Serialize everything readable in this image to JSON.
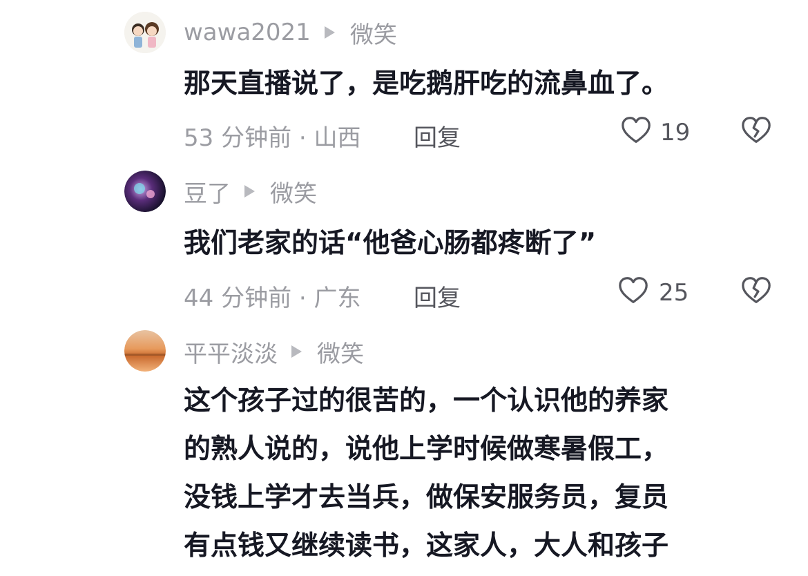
{
  "comments": [
    {
      "username": "wawa2021",
      "reply_to": "微笑",
      "lines": [
        "那天直播说了，是吃鹅肝吃的流鼻血了。"
      ],
      "time_location": "53 分钟前 · 山西",
      "reply_label": "回复",
      "likes": "19"
    },
    {
      "username": "豆了",
      "reply_to": "微笑",
      "lines": [
        "我们老家的话“他爸心肠都疼断了”"
      ],
      "time_location": "44 分钟前 · 广东",
      "reply_label": "回复",
      "likes": "25"
    },
    {
      "username": "平平淡淡",
      "reply_to": "微笑",
      "lines": [
        "这个孩子过的很苦的，一个认识他的养家",
        "的熟人说的，说他上学时候做寒暑假工，",
        "没钱上学才去当兵，做保安服务员，复员",
        "有点钱又继续读书，这家人，大人和孩子"
      ]
    }
  ],
  "icons": {
    "like": "heart-outline-icon",
    "dislike": "broken-heart-icon",
    "reply_arrow": "play-triangle-icon"
  },
  "colors": {
    "text": "#161823",
    "meta": "#9b9ca2",
    "secondary": "#55565d"
  }
}
